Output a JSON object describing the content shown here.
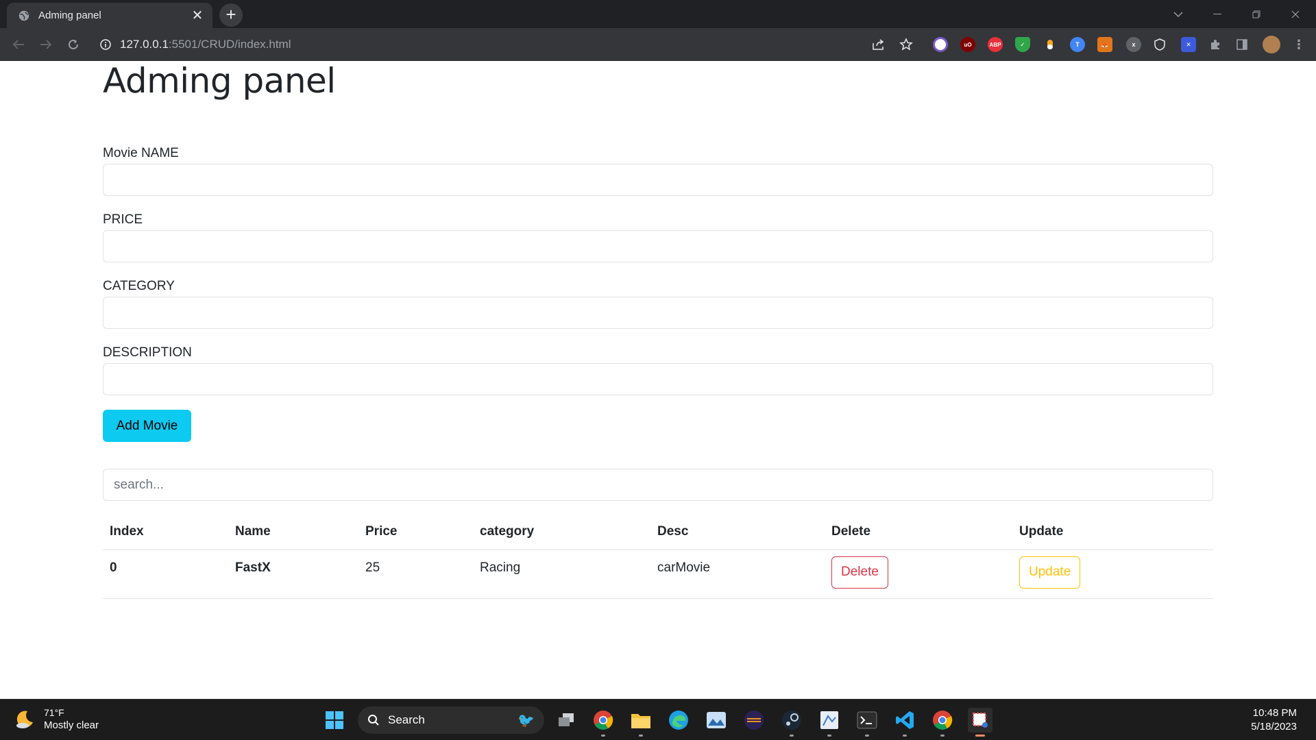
{
  "browser": {
    "tab_title": "Adming panel",
    "url_host": "127.0.0.1",
    "url_rest": ":5501/CRUD/index.html"
  },
  "page": {
    "title": "Adming panel",
    "fields": [
      {
        "label": "Movie NAME",
        "value": "",
        "placeholder": ""
      },
      {
        "label": "PRICE",
        "value": "",
        "placeholder": ""
      },
      {
        "label": "CATEGORY",
        "value": "",
        "placeholder": ""
      },
      {
        "label": "DESCRIPTION",
        "value": "",
        "placeholder": ""
      }
    ],
    "add_button": "Add Movie",
    "search": {
      "placeholder": "search...",
      "value": ""
    },
    "table": {
      "headers": [
        "Index",
        "Name",
        "Price",
        "category",
        "Desc",
        "Delete",
        "Update"
      ],
      "rows": [
        {
          "index": "0",
          "name": "FastX",
          "price": "25",
          "category": "Racing",
          "desc": "carMovie",
          "delete_label": "Delete",
          "update_label": "Update"
        }
      ]
    }
  },
  "taskbar": {
    "weather_temp": "71°F",
    "weather_cond": "Mostly clear",
    "search_label": "Search",
    "time": "10:48 PM",
    "date": "5/18/2023"
  },
  "colors": {
    "info": "#0dcaf0",
    "danger": "#dc3545",
    "warning": "#ffc107"
  }
}
